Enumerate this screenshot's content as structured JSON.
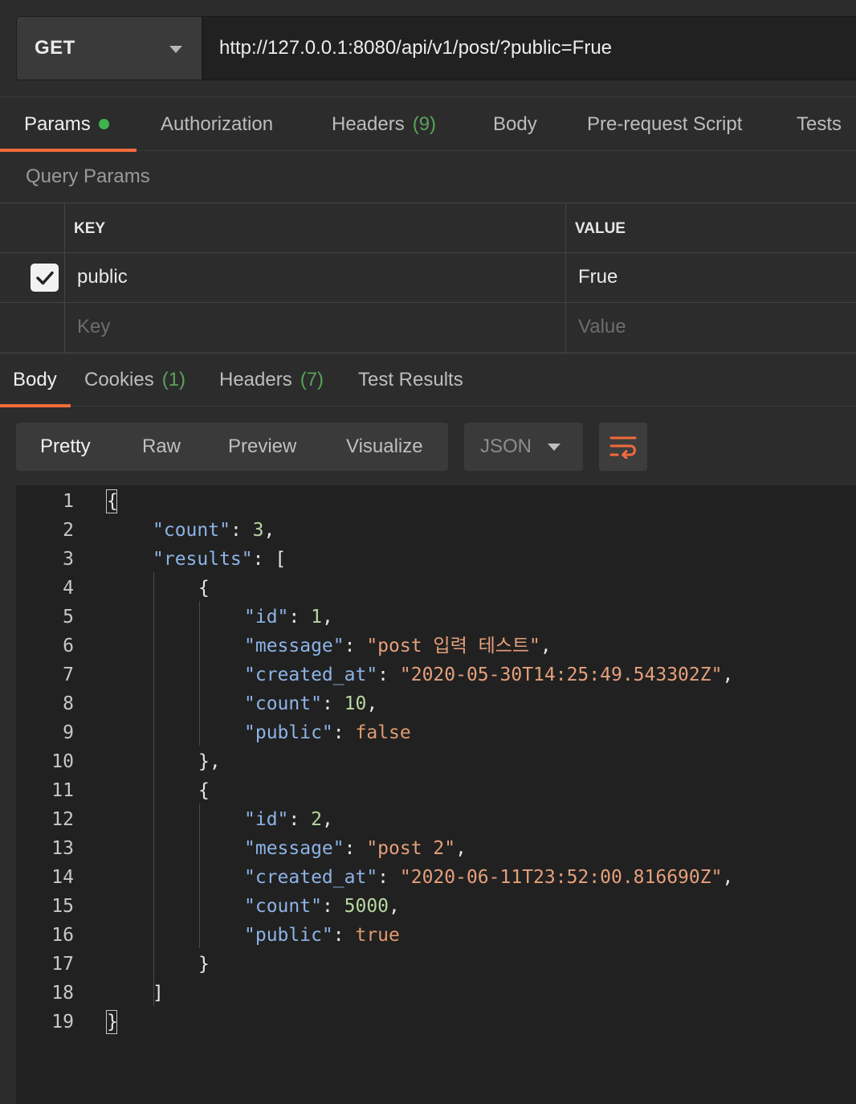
{
  "request": {
    "method": "GET",
    "url": "http://127.0.0.1:8080/api/v1/post/?public=Frue"
  },
  "request_tabs": [
    {
      "label": "Params",
      "active": true,
      "has_dot": true
    },
    {
      "label": "Authorization"
    },
    {
      "label": "Headers",
      "count": "(9)"
    },
    {
      "label": "Body"
    },
    {
      "label": "Pre-request Script"
    },
    {
      "label": "Tests"
    }
  ],
  "query_params": {
    "title": "Query Params",
    "headers": {
      "key": "KEY",
      "value": "VALUE"
    },
    "rows": [
      {
        "checked": true,
        "key": "public",
        "value": "Frue"
      }
    ],
    "placeholder": {
      "key": "Key",
      "value": "Value"
    }
  },
  "response_tabs": [
    {
      "label": "Body",
      "active": true
    },
    {
      "label": "Cookies",
      "count": "(1)"
    },
    {
      "label": "Headers",
      "count": "(7)"
    },
    {
      "label": "Test Results"
    }
  ],
  "toolbar": {
    "views": [
      "Pretty",
      "Raw",
      "Preview",
      "Visualize"
    ],
    "active_view": "Pretty",
    "format": "JSON"
  },
  "colors": {
    "accent": "#f26b3a",
    "status_green": "#3fb24c",
    "json_key": "#8db3e6",
    "json_string": "#e5a07b",
    "json_number": "#b8d7a3"
  },
  "code_lines": [
    {
      "n": "1",
      "parts": [
        {
          "t": "{",
          "c": "p"
        }
      ]
    },
    {
      "n": "2",
      "parts": [
        {
          "t": "\"count\"",
          "c": "k"
        },
        {
          "t": ": ",
          "c": "p"
        },
        {
          "t": "3",
          "c": "num"
        },
        {
          "t": ",",
          "c": "p"
        }
      ]
    },
    {
      "n": "3",
      "parts": [
        {
          "t": "\"results\"",
          "c": "k"
        },
        {
          "t": ": [",
          "c": "p"
        }
      ]
    },
    {
      "n": "4",
      "parts": [
        {
          "t": "{",
          "c": "p"
        }
      ]
    },
    {
      "n": "5",
      "parts": [
        {
          "t": "\"id\"",
          "c": "k"
        },
        {
          "t": ": ",
          "c": "p"
        },
        {
          "t": "1",
          "c": "num"
        },
        {
          "t": ",",
          "c": "p"
        }
      ]
    },
    {
      "n": "6",
      "parts": [
        {
          "t": "\"message\"",
          "c": "k"
        },
        {
          "t": ": ",
          "c": "p"
        },
        {
          "t": "\"post 입력 테스트\"",
          "c": "str"
        },
        {
          "t": ",",
          "c": "p"
        }
      ]
    },
    {
      "n": "7",
      "parts": [
        {
          "t": "\"created_at\"",
          "c": "k"
        },
        {
          "t": ": ",
          "c": "p"
        },
        {
          "t": "\"2020-05-30T14:25:49.543302Z\"",
          "c": "str"
        },
        {
          "t": ",",
          "c": "p"
        }
      ]
    },
    {
      "n": "8",
      "parts": [
        {
          "t": "\"count\"",
          "c": "k"
        },
        {
          "t": ": ",
          "c": "p"
        },
        {
          "t": "10",
          "c": "num"
        },
        {
          "t": ",",
          "c": "p"
        }
      ]
    },
    {
      "n": "9",
      "parts": [
        {
          "t": "\"public\"",
          "c": "k"
        },
        {
          "t": ": ",
          "c": "p"
        },
        {
          "t": "false",
          "c": "bool"
        }
      ]
    },
    {
      "n": "10",
      "parts": [
        {
          "t": "},",
          "c": "p"
        }
      ]
    },
    {
      "n": "11",
      "parts": [
        {
          "t": "{",
          "c": "p"
        }
      ]
    },
    {
      "n": "12",
      "parts": [
        {
          "t": "\"id\"",
          "c": "k"
        },
        {
          "t": ": ",
          "c": "p"
        },
        {
          "t": "2",
          "c": "num"
        },
        {
          "t": ",",
          "c": "p"
        }
      ]
    },
    {
      "n": "13",
      "parts": [
        {
          "t": "\"message\"",
          "c": "k"
        },
        {
          "t": ": ",
          "c": "p"
        },
        {
          "t": "\"post 2\"",
          "c": "str"
        },
        {
          "t": ",",
          "c": "p"
        }
      ]
    },
    {
      "n": "14",
      "parts": [
        {
          "t": "\"created_at\"",
          "c": "k"
        },
        {
          "t": ": ",
          "c": "p"
        },
        {
          "t": "\"2020-06-11T23:52:00.816690Z\"",
          "c": "str"
        },
        {
          "t": ",",
          "c": "p"
        }
      ]
    },
    {
      "n": "15",
      "parts": [
        {
          "t": "\"count\"",
          "c": "k"
        },
        {
          "t": ": ",
          "c": "p"
        },
        {
          "t": "5000",
          "c": "num"
        },
        {
          "t": ",",
          "c": "p"
        }
      ]
    },
    {
      "n": "16",
      "parts": [
        {
          "t": "\"public\"",
          "c": "k"
        },
        {
          "t": ": ",
          "c": "p"
        },
        {
          "t": "true",
          "c": "bool"
        }
      ]
    },
    {
      "n": "17",
      "parts": [
        {
          "t": "}",
          "c": "p"
        }
      ]
    },
    {
      "n": "18",
      "parts": [
        {
          "t": "]",
          "c": "p"
        }
      ]
    },
    {
      "n": "19",
      "parts": [
        {
          "t": "}",
          "c": "p"
        }
      ]
    }
  ]
}
